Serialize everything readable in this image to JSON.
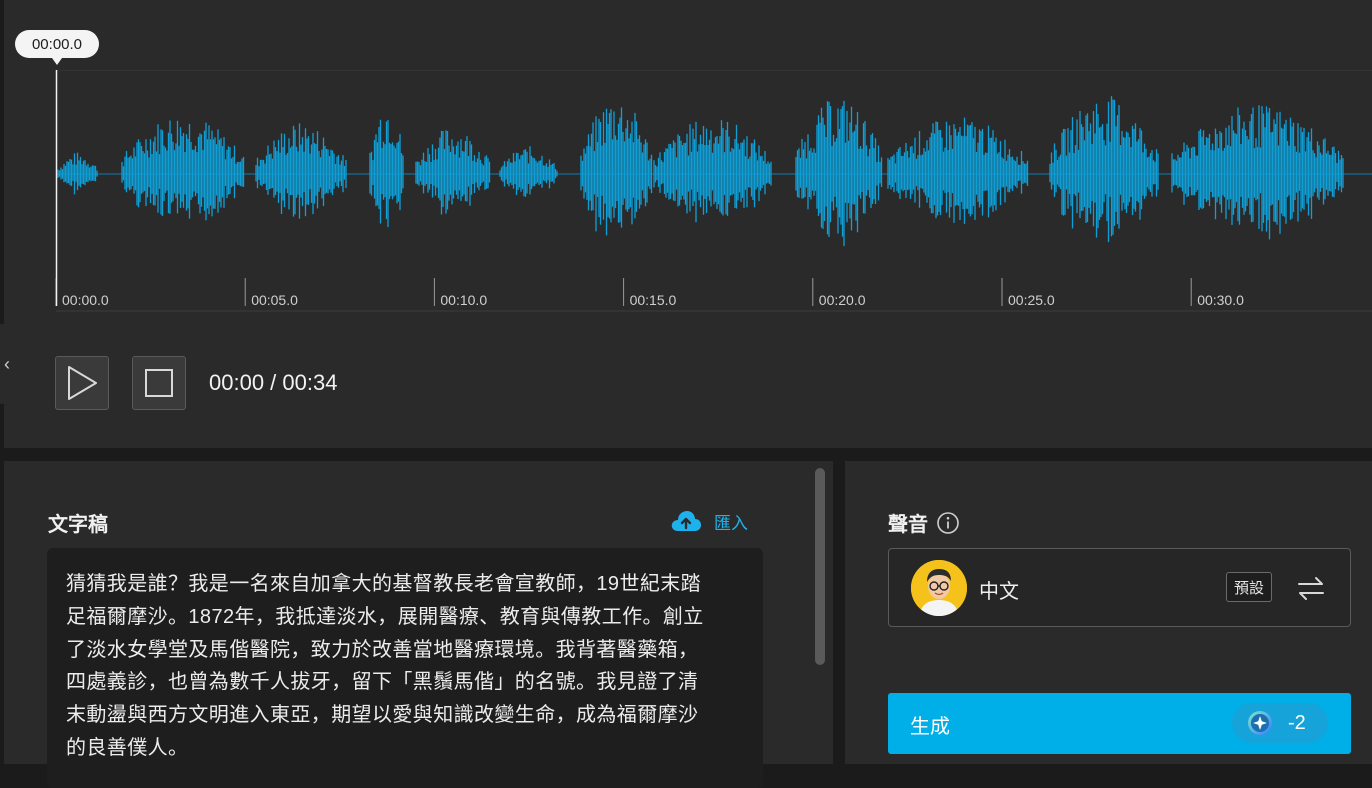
{
  "waveform": {
    "playhead_time": "00:00.0",
    "ticks": [
      "00:00.0",
      "00:05.0",
      "00:10.0",
      "00:15.0",
      "00:20.0",
      "00:25.0",
      "00:30.0"
    ],
    "wave_color": "#0e9fd6"
  },
  "player": {
    "time_readout": "00:00 / 00:34",
    "play_icon": "play-icon",
    "stop_icon": "stop-icon"
  },
  "script": {
    "title": "文字稿",
    "import_label": "匯入",
    "lines": [
      "猜猜我是誰？我是一名來自加拿大的基督教長老會宣教師，19世紀末踏",
      "足福爾摩沙。1872年，我抵達淡水，展開醫療、教育與傳教工作。創立",
      "了淡水女學堂及馬偕醫院，致力於改善當地醫療環境。我背著醫藥箱，",
      "四處義診，也曾為數千人拔牙，留下「黑鬚馬偕」的名號。我見證了清",
      "末動盪與西方文明進入東亞，期望以愛與知識改變生命，成為福爾摩沙",
      "的良善僕人。"
    ]
  },
  "voice": {
    "title": "聲音",
    "name": "中文",
    "default_badge": "預設",
    "accent": "#00aee8"
  },
  "generate": {
    "label": "生成",
    "credit": "-2"
  }
}
